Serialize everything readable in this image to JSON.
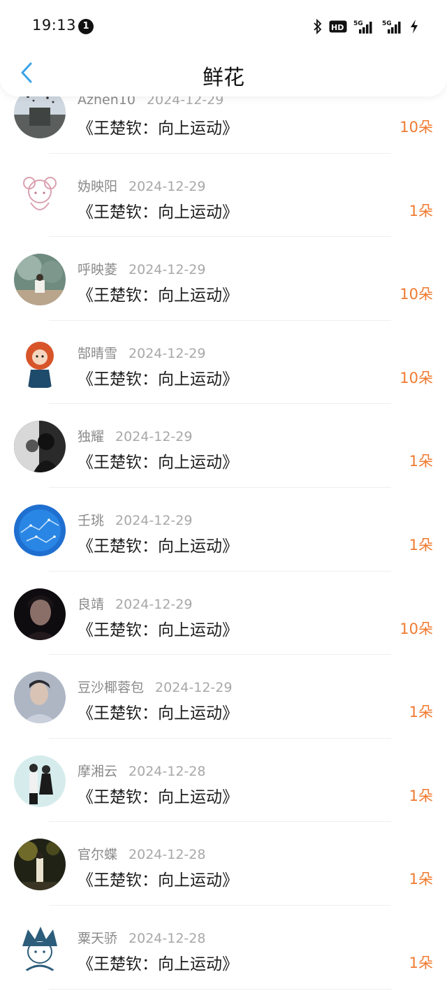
{
  "status_bar": {
    "time": "19:13",
    "notification_count": "1",
    "icons": [
      "bluetooth-icon",
      "hd-voice-icon",
      "signal-5g-icon",
      "signal-5g-icon",
      "charging-icon"
    ]
  },
  "header": {
    "title": "鲜花",
    "back_icon": "chevron-left-icon"
  },
  "colors": {
    "accent": "#3aa3e8",
    "count_color": "#f07a30"
  },
  "list": [
    {
      "name": "Azhen10",
      "date": "2024-12-29",
      "book": "《王楚钦：向上运动》",
      "count": "10朵"
    },
    {
      "name": "妫映阳",
      "date": "2024-12-29",
      "book": "《王楚钦：向上运动》",
      "count": "1朵"
    },
    {
      "name": "呼映菱",
      "date": "2024-12-29",
      "book": "《王楚钦：向上运动》",
      "count": "10朵"
    },
    {
      "name": "郜晴雪",
      "date": "2024-12-29",
      "book": "《王楚钦：向上运动》",
      "count": "10朵"
    },
    {
      "name": "独耀",
      "date": "2024-12-29",
      "book": "《王楚钦：向上运动》",
      "count": "1朵"
    },
    {
      "name": "壬珧",
      "date": "2024-12-29",
      "book": "《王楚钦：向上运动》",
      "count": "1朵"
    },
    {
      "name": "良靖",
      "date": "2024-12-29",
      "book": "《王楚钦：向上运动》",
      "count": "10朵"
    },
    {
      "name": "豆沙椰蓉包",
      "date": "2024-12-29",
      "book": "《王楚钦：向上运动》",
      "count": "1朵"
    },
    {
      "name": "摩湘云",
      "date": "2024-12-28",
      "book": "《王楚钦：向上运动》",
      "count": "1朵"
    },
    {
      "name": "官尔蝶",
      "date": "2024-12-28",
      "book": "《王楚钦：向上运动》",
      "count": "1朵"
    },
    {
      "name": "粟天骄",
      "date": "2024-12-28",
      "book": "《王楚钦：向上运动》",
      "count": "1朵"
    }
  ]
}
